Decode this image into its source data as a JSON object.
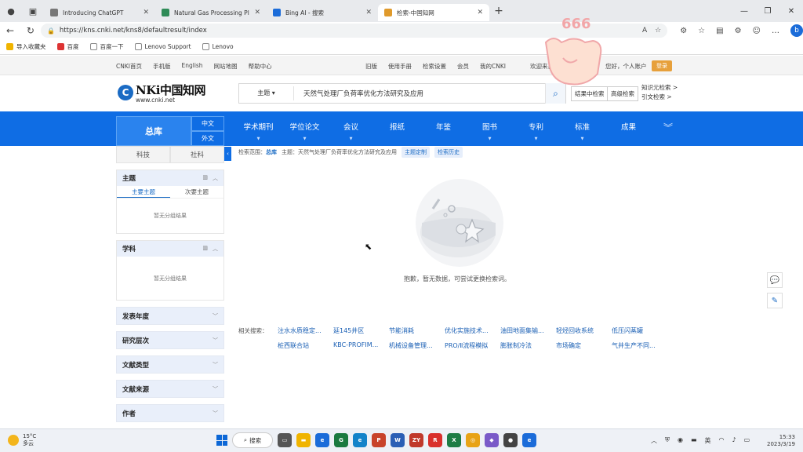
{
  "browser": {
    "tabs": [
      {
        "title": "Introducing ChatGPT",
        "color": "#777777",
        "active": false
      },
      {
        "title": "Natural Gas Processing Plant Loa",
        "color": "#2e8b57",
        "active": false
      },
      {
        "title": "Bing AI - 搜索",
        "color": "#1b6cd9",
        "active": false
      },
      {
        "title": "检索-中国知网",
        "color": "#e09a2b",
        "active": true
      }
    ],
    "url": "https://kns.cnki.net/kns8/defaultresult/index",
    "bookmarks": [
      "导入收藏夹",
      "百度",
      "百度一下",
      "Lenovo Support",
      "Lenovo"
    ]
  },
  "topbar": {
    "left_links": [
      "CNKI首页",
      "手机版",
      "English",
      "网站地图",
      "帮助中心"
    ],
    "mid_links": [
      "旧版",
      "使用手册",
      "检索设置",
      "会员",
      "我的CNKI"
    ],
    "welcome": "欢迎来自",
    "user": "您好，个人账户",
    "login": "登录"
  },
  "logo": {
    "mark": "C",
    "main": "NKi中国知网",
    "sub": "www.cnki.net"
  },
  "search": {
    "field": "主题",
    "query": "天然气处理厂负荷率优化方法研究及应用",
    "adv_buttons": [
      "结果中检索",
      "高级检索"
    ],
    "side_links": [
      "知识元检索 >",
      "引文检索 >"
    ]
  },
  "nav": {
    "main_tab": "总库",
    "lang": [
      "中文",
      "外文"
    ],
    "items": [
      "学术期刊",
      "学位论文",
      "会议",
      "报纸",
      "年鉴",
      "图书",
      "专利",
      "标准",
      "成果"
    ]
  },
  "sidebar": {
    "tabs": [
      "科技",
      "社科"
    ],
    "panels": [
      {
        "title": "主题",
        "sub": [
          "主要主题",
          "次要主题"
        ],
        "empty": "暂无分组结果"
      },
      {
        "title": "学科",
        "sub": [],
        "empty": "暂无分组结果"
      }
    ],
    "facets": [
      "发表年度",
      "研究层次",
      "文献类型",
      "文献来源",
      "作者"
    ]
  },
  "crumbs": {
    "scope_label": "检索范围：",
    "scope": "总库",
    "topic": "主题：天然气处理厂负荷率优化方法研究及应用",
    "btn1": "主题定制",
    "btn2": "检索历史"
  },
  "empty_message": "抱歉，暂无数据，可尝试更换检索词。",
  "related": {
    "label": "相关搜索：",
    "items": [
      "注水水质稳定...",
      "延145井区",
      "节能消耗",
      "优化实施技术...",
      "油田地面集输...",
      "轻烃回收系统",
      "低压闪蒸罐",
      "桩西联合站",
      "KBC-PROFIM...",
      "机械设备管理...",
      "PRO/Ⅱ流程模拟",
      "膨胀制冷法",
      "市场确定",
      "气井生产不同..."
    ]
  },
  "sticker_text": "666",
  "taskbar": {
    "temp": "15°C",
    "weather": "多云",
    "search": "搜索",
    "time": "15:33",
    "date": "2023/3/19"
  }
}
